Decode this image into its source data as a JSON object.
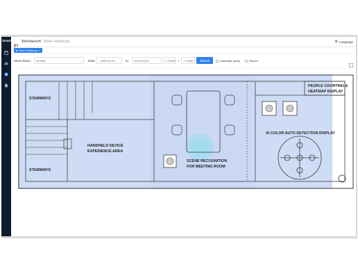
{
  "app": {
    "brand": "Smart"
  },
  "sidebar": {
    "items": [
      {
        "icon": "store-icon"
      },
      {
        "icon": "chart-icon"
      },
      {
        "icon": "heatmap-icon"
      },
      {
        "icon": "document-icon"
      }
    ]
  },
  "header": {
    "breadcrumb_root": "Workbench",
    "breadcrumb_sep": "/",
    "breadcrumb_current": "Store Heatmap",
    "language": "Language"
  },
  "tabs": [
    {
      "label": "Store Heatmap"
    }
  ],
  "filters": {
    "store_label": "Store Name",
    "store_value": "20XWK",
    "date_label": "Date",
    "date_from": "2024-10-20",
    "to_label": "to",
    "date_to": "2024-10-20",
    "time_from": "00:00",
    "time_sep": "~",
    "time_to": "16:00",
    "search_label": "Search",
    "auto_query_label": "Automatic query",
    "recent_label": "Recent"
  },
  "map": {
    "labels": {
      "stairways_top": "STAIRWAYS",
      "stairways_bottom": "STAIRWAYS",
      "handheld_1": "HANDHELD DEVICE",
      "handheld_2": "EXPERIENCE AREA",
      "scene_1": "SCENE RECOGNITION",
      "scene_2": "FOR MEETING ROOM",
      "people_1": "PEOPLE COUNTING &",
      "people_2": "HEATMAP DISPLAY",
      "ai_color": "AI COLOR AUTO DETECTION DISPLAY"
    },
    "colors": {
      "heat_overlay": "#cfdcf5",
      "hotspot": "#8fe0f0",
      "walls": "#3a3a3a"
    }
  }
}
